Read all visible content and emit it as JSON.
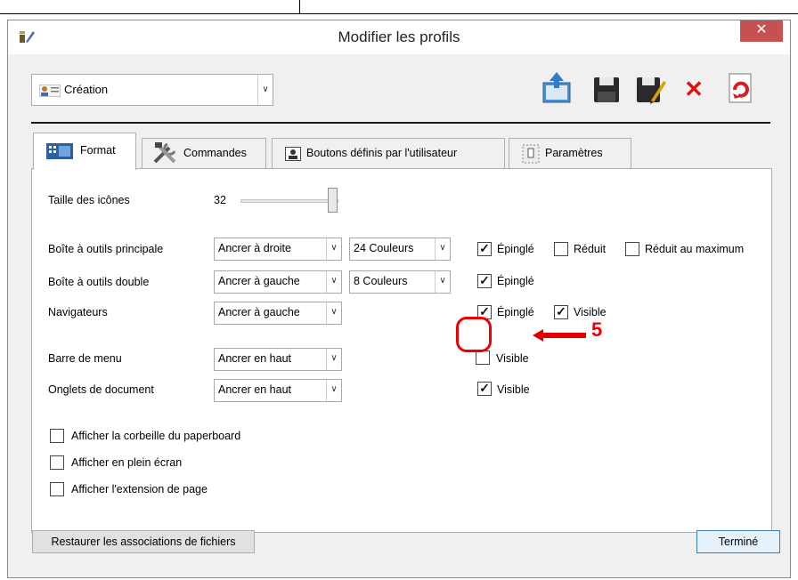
{
  "window": {
    "title": "Modifier les profils",
    "close_glyph": "✕"
  },
  "profile": {
    "selected": "Création",
    "arrow": "∨"
  },
  "toolbar": {
    "icons": [
      "export-profile-icon",
      "save-icon",
      "save-as-icon",
      "delete-icon",
      "refresh-icon"
    ],
    "delete_glyph": "✕"
  },
  "tabs": [
    {
      "label": "Format"
    },
    {
      "label": "Commandes"
    },
    {
      "label": "Boutons définis par l'utilisateur"
    },
    {
      "label": "Paramètres"
    }
  ],
  "format": {
    "icon_size": {
      "label": "Taille des icônes",
      "value": "32"
    },
    "rows": [
      {
        "label": "Boîte à outils principale",
        "dock": "Ancrer à droite",
        "colors": "24 Couleurs"
      },
      {
        "label": "Boîte à outils double",
        "dock": "Ancrer à gauche",
        "colors": "8 Couleurs"
      },
      {
        "label": "Navigateurs",
        "dock": "Ancrer à gauche"
      },
      {
        "label": "Barre de menu",
        "dock": "Ancrer en haut"
      },
      {
        "label": "Onglets de document",
        "dock": "Ancrer en haut"
      }
    ],
    "checks": {
      "pinned": "Épinglé",
      "reduced": "Réduit",
      "max_reduced": "Réduit au maximum",
      "visible": "Visible"
    },
    "options": [
      {
        "label": "Afficher la corbeille du paperboard",
        "checked": false
      },
      {
        "label": "Afficher en plein écran",
        "checked": false
      },
      {
        "label": "Afficher l'extension de page",
        "checked": false
      }
    ]
  },
  "annotation": {
    "number": "5",
    "color": "#e00000"
  },
  "buttons": {
    "restore": "Restaurer les associations de fichiers",
    "done": "Terminé"
  }
}
